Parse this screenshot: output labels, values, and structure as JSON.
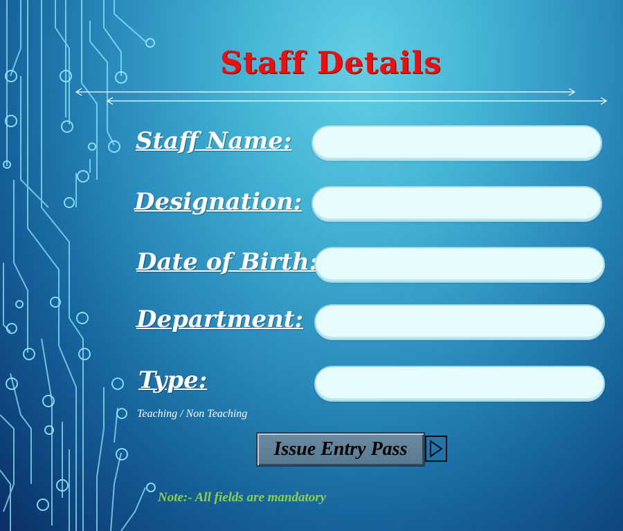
{
  "form": {
    "title": "Staff Details",
    "fields": [
      {
        "label": "Staff Name:",
        "value": ""
      },
      {
        "label": "Designation:",
        "value": ""
      },
      {
        "label": "Date of Birth:",
        "value": ""
      },
      {
        "label": "Department:",
        "value": ""
      },
      {
        "label": "Type:",
        "value": ""
      }
    ],
    "type_hint": "Teaching / Non Teaching",
    "submit_label": "Issue Entry Pass",
    "submit_icon": "play-triangle-icon",
    "note": "Note:- All fields are mandatory"
  },
  "colors": {
    "title": "#f10d0d",
    "note": "#8bd24a",
    "field_bg": "#e6fbfd",
    "button_bg": "#6a8aa0"
  }
}
